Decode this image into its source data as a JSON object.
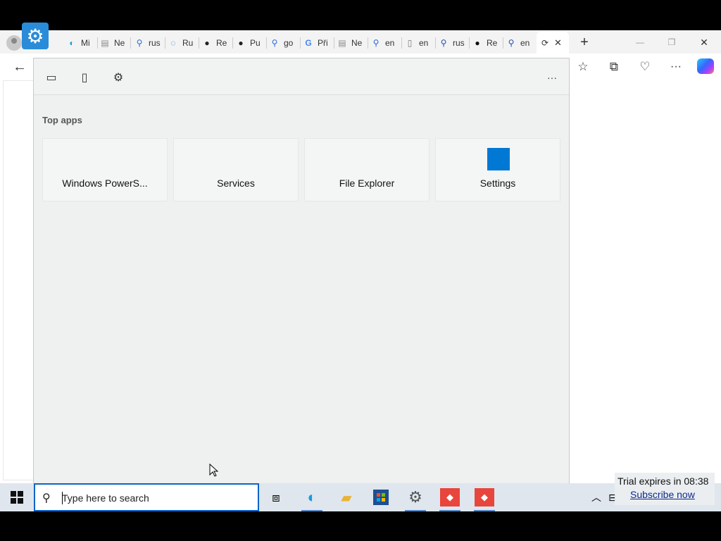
{
  "browser": {
    "tabs": [
      {
        "label": "Mi",
        "icon": "edge-icon"
      },
      {
        "label": "Ne",
        "icon": "newtab-icon"
      },
      {
        "label": "rus",
        "icon": "search-icon"
      },
      {
        "label": "Ru",
        "icon": "loading-icon"
      },
      {
        "label": "Re",
        "icon": "github-icon"
      },
      {
        "label": "Pu",
        "icon": "github-icon"
      },
      {
        "label": "go",
        "icon": "search-icon"
      },
      {
        "label": "Při",
        "icon": "google-icon"
      },
      {
        "label": "Ne",
        "icon": "newtab-icon"
      },
      {
        "label": "en",
        "icon": "search-icon"
      },
      {
        "label": "en",
        "icon": "page-icon"
      },
      {
        "label": "rus",
        "icon": "search-icon"
      },
      {
        "label": "Re",
        "icon": "github-icon"
      },
      {
        "label": "en",
        "icon": "search-icon"
      }
    ],
    "new_tab_glyph": "+",
    "window_controls": {
      "minimize": "—",
      "restore": "❐",
      "close": "✕"
    }
  },
  "start_panel": {
    "section_title": "Top apps",
    "more_glyph": "···",
    "apps": [
      {
        "label": "Windows PowerS..."
      },
      {
        "label": "Services"
      },
      {
        "label": "File Explorer"
      },
      {
        "label": "Settings"
      }
    ],
    "accent_color": "#0078d4"
  },
  "taskbar": {
    "search_placeholder": "Type here to search"
  },
  "trial_notice": {
    "expires_text": "Trial expires in 08:38",
    "subscribe_link": "Subscribe now"
  }
}
